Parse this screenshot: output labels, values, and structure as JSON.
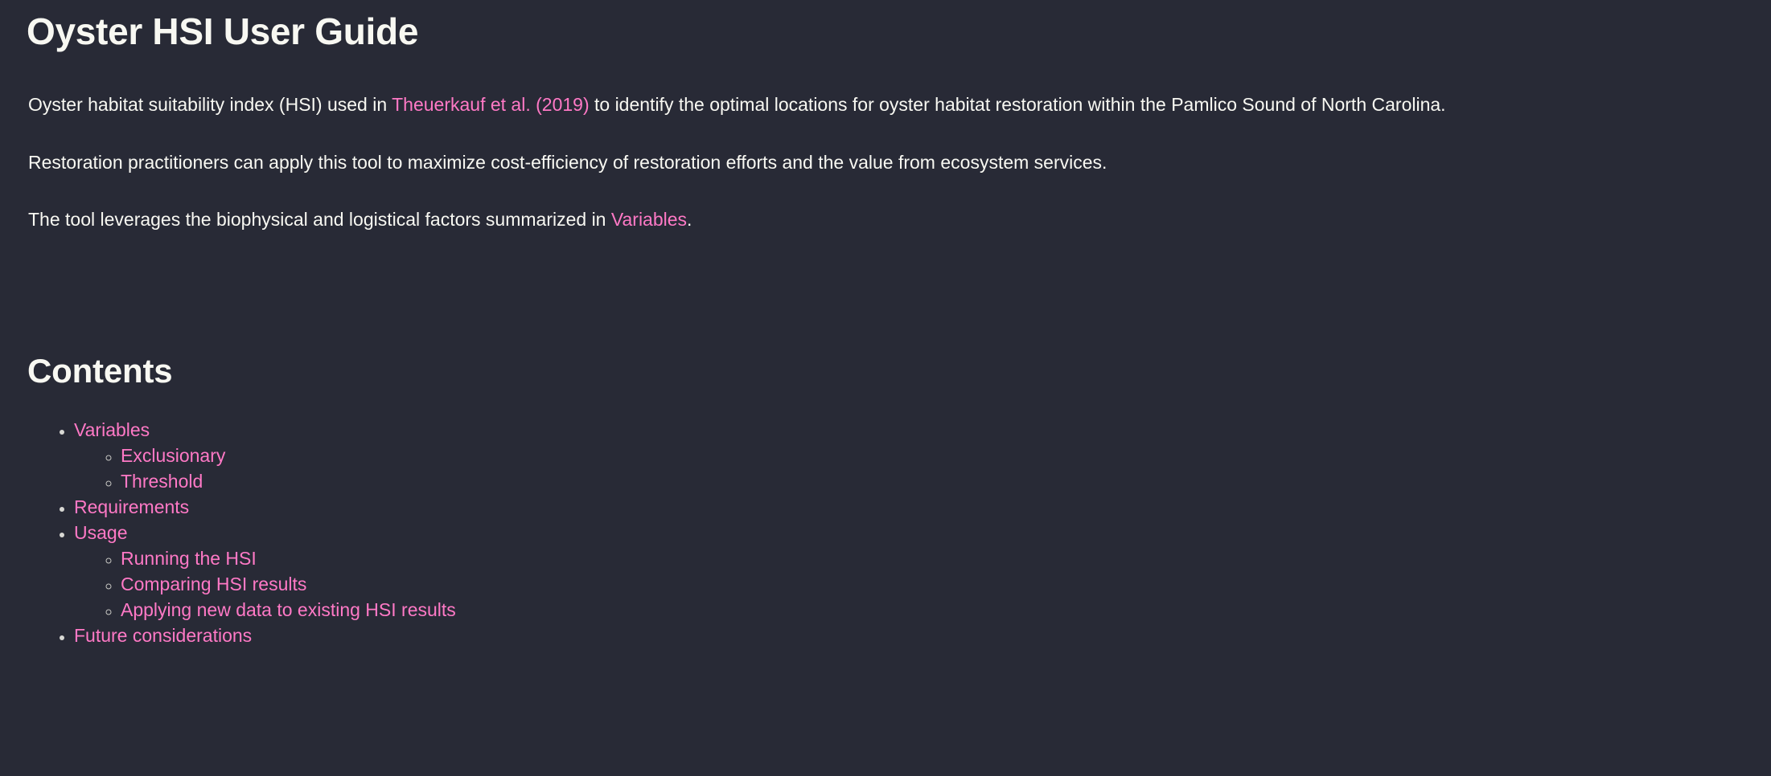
{
  "document": {
    "title": "Oyster HSI User Guide",
    "colors": {
      "background": "#282a36",
      "text": "#f8f8f2",
      "link": "#ff79c6"
    },
    "paragraphs": {
      "p1": {
        "before_link": "Oyster habitat suitability index (HSI) used in ",
        "link": "Theuerkauf et al. (2019)",
        "after_link": " to identify the optimal locations for oyster habitat restoration within the Pamlico Sound of North Carolina."
      },
      "p2": {
        "text": "Restoration practitioners can apply this tool to maximize cost-efficiency of restoration efforts and the value from ecosystem services."
      },
      "p3": {
        "before_link": "The tool leverages the biophysical and logistical factors summarized in ",
        "link": "Variables",
        "after_link": "."
      }
    },
    "contents": {
      "heading": "Contents",
      "items": [
        {
          "label": "Variables",
          "children": [
            {
              "label": "Exclusionary"
            },
            {
              "label": "Threshold"
            }
          ]
        },
        {
          "label": "Requirements",
          "children": []
        },
        {
          "label": "Usage",
          "children": [
            {
              "label": "Running the HSI"
            },
            {
              "label": "Comparing HSI results"
            },
            {
              "label": "Applying new data to existing HSI results"
            }
          ]
        },
        {
          "label": "Future considerations",
          "children": []
        }
      ]
    }
  }
}
